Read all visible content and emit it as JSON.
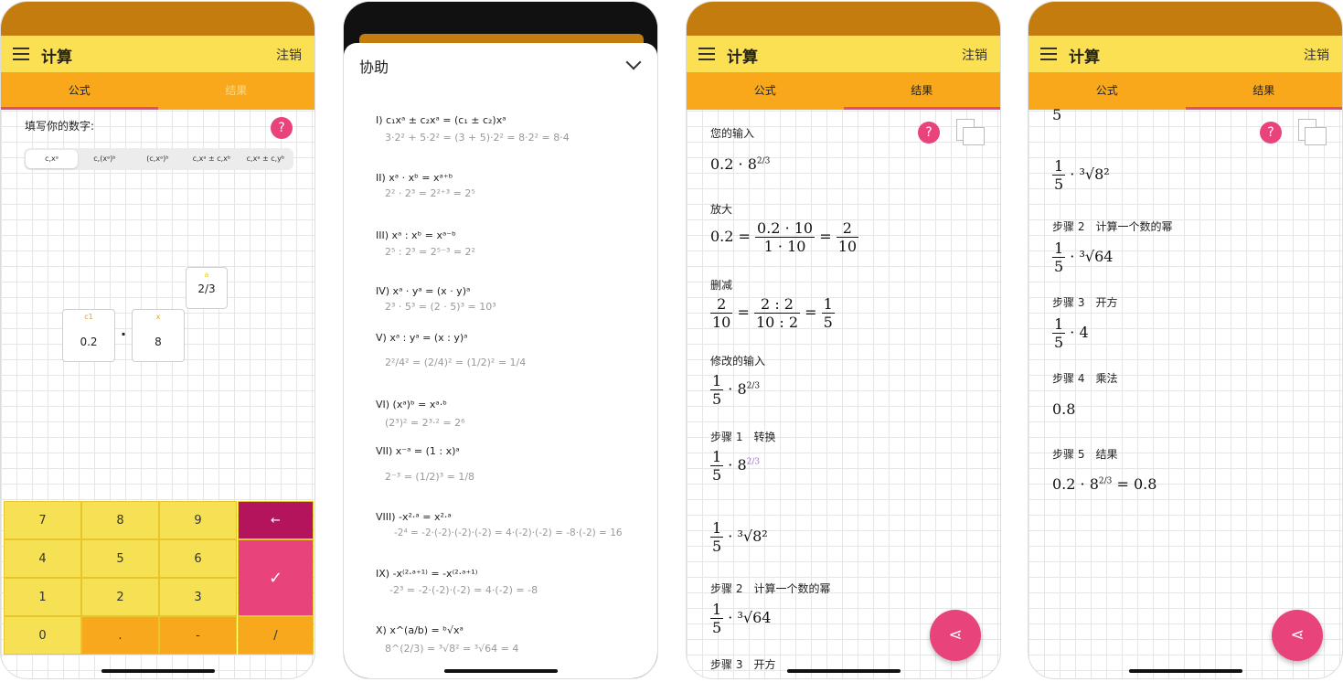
{
  "app": {
    "title": "计算",
    "logout": "注销",
    "tab_formula": "公式",
    "tab_result": "结果",
    "help_icon": "?"
  },
  "phone1": {
    "prompt": "填写你的数字:",
    "segments": [
      "c,xᵃ",
      "c,(xᵃ)ᵇ",
      "(c,xᵃ)ᵇ",
      "c,xᵃ ± c,xᵇ",
      "c,xᵃ ± c,yᵇ"
    ],
    "inputs": {
      "c1_label": "c1",
      "c1_value": "0.2",
      "x_label": "x",
      "x_value": "8",
      "a_label": "a",
      "a_value": "2/3",
      "dot": "·"
    },
    "keys": {
      "k7": "7",
      "k8": "8",
      "k9": "9",
      "k4": "4",
      "k5": "5",
      "k6": "6",
      "k1": "1",
      "k2": "2",
      "k3": "3",
      "k0": "0",
      "dot": ".",
      "minus": "-",
      "slash": "/",
      "back": "←",
      "ok": "✓"
    }
  },
  "phone2": {
    "title": "协助",
    "rules": [
      {
        "r": "I) c₁xᵃ ± c₂xᵃ = (c₁ ± c₂)xᵃ",
        "e": "3·2² + 5·2² = (3 + 5)·2² = 8·2² = 8·4"
      },
      {
        "r": "II) xᵃ · xᵇ = xᵃ⁺ᵇ",
        "e": "2² · 2³ = 2²⁺³ = 2⁵"
      },
      {
        "r": "III) xᵃ : xᵇ = xᵃ⁻ᵇ",
        "e": "2⁵ : 2³ = 2⁵⁻³ = 2²"
      },
      {
        "r": "IV) xᵃ · yᵃ = (x · y)ᵃ",
        "e": "2³ · 5³ = (2 · 5)³ = 10³"
      },
      {
        "r": "V) xᵃ : yᵃ = (x : y)ᵃ",
        "e": "2²/4² = (2/4)² = (1/2)² = 1/4"
      },
      {
        "r": "VI) (xᵃ)ᵇ = xᵃ·ᵇ",
        "e": "(2³)² = 2³·² = 2⁶"
      },
      {
        "r": "VII) x⁻ᵃ = (1 : x)ᵃ",
        "e": "2⁻³ = (1/2)³ = 1/8"
      },
      {
        "r": "VIII) -x²·ᵃ = x²·ᵃ",
        "e": "-2⁴ = -2·(-2)·(-2)·(-2) = 4·(-2)·(-2) = -8·(-2) = 16"
      },
      {
        "r": "IX) -x⁽²·ᵃ⁺¹⁾ = -x⁽²·ᵃ⁺¹⁾",
        "e": "-2³ = -2·(-2)·(-2) = 4·(-2) = -8"
      },
      {
        "r": "X) x^(a/b) = ᵇ√xᵃ",
        "e": "8^(2/3) = ³√8² = ³√64 = 4"
      }
    ]
  },
  "phone3": {
    "your_input": "您的输入",
    "enlarge": "放大",
    "reduce": "删减",
    "modified_input": "修改的输入",
    "step1": "步骤 1　转换",
    "step2": "步骤 2　计算一个数的幂",
    "step3": "步骤 3　开方",
    "m_input_base": "0.2 · 8",
    "m_exp": "2/3",
    "f_02": "0.2 =",
    "f_num1": "0.2 · 10",
    "f_den1": "1 · 10",
    "f_eq": "=",
    "f_num2": "2",
    "f_den2": "10",
    "g_num1": "2",
    "g_den1": "10",
    "g_num2": "2 : 2",
    "g_den2": "10 : 2",
    "g_num3": "1",
    "g_den3": "5",
    "dot8": "· 8",
    "sqrt_8": "· ³√8²",
    "sqrt_64": "· ³√64"
  },
  "phone4": {
    "step2": "步骤 2　计算一个数的幂",
    "step3": "步骤 3　开方",
    "step4": "步骤 4　乘法",
    "step5": "步骤 5　结果",
    "top_partial": "5",
    "r1": "· ³√8²",
    "r2": "· ³√64",
    "r3": "· 4",
    "r4": "0.8",
    "r5": "0.2 · 8",
    "r5_exp": "2/3",
    "r5_tail": "= 0.8",
    "one": "1",
    "five": "5"
  },
  "colors": {
    "status": "#c47c0e",
    "appbar": "#fbe053",
    "tabs": "#f9a81b",
    "accent": "#e8437b",
    "back_key": "#b3145b"
  }
}
